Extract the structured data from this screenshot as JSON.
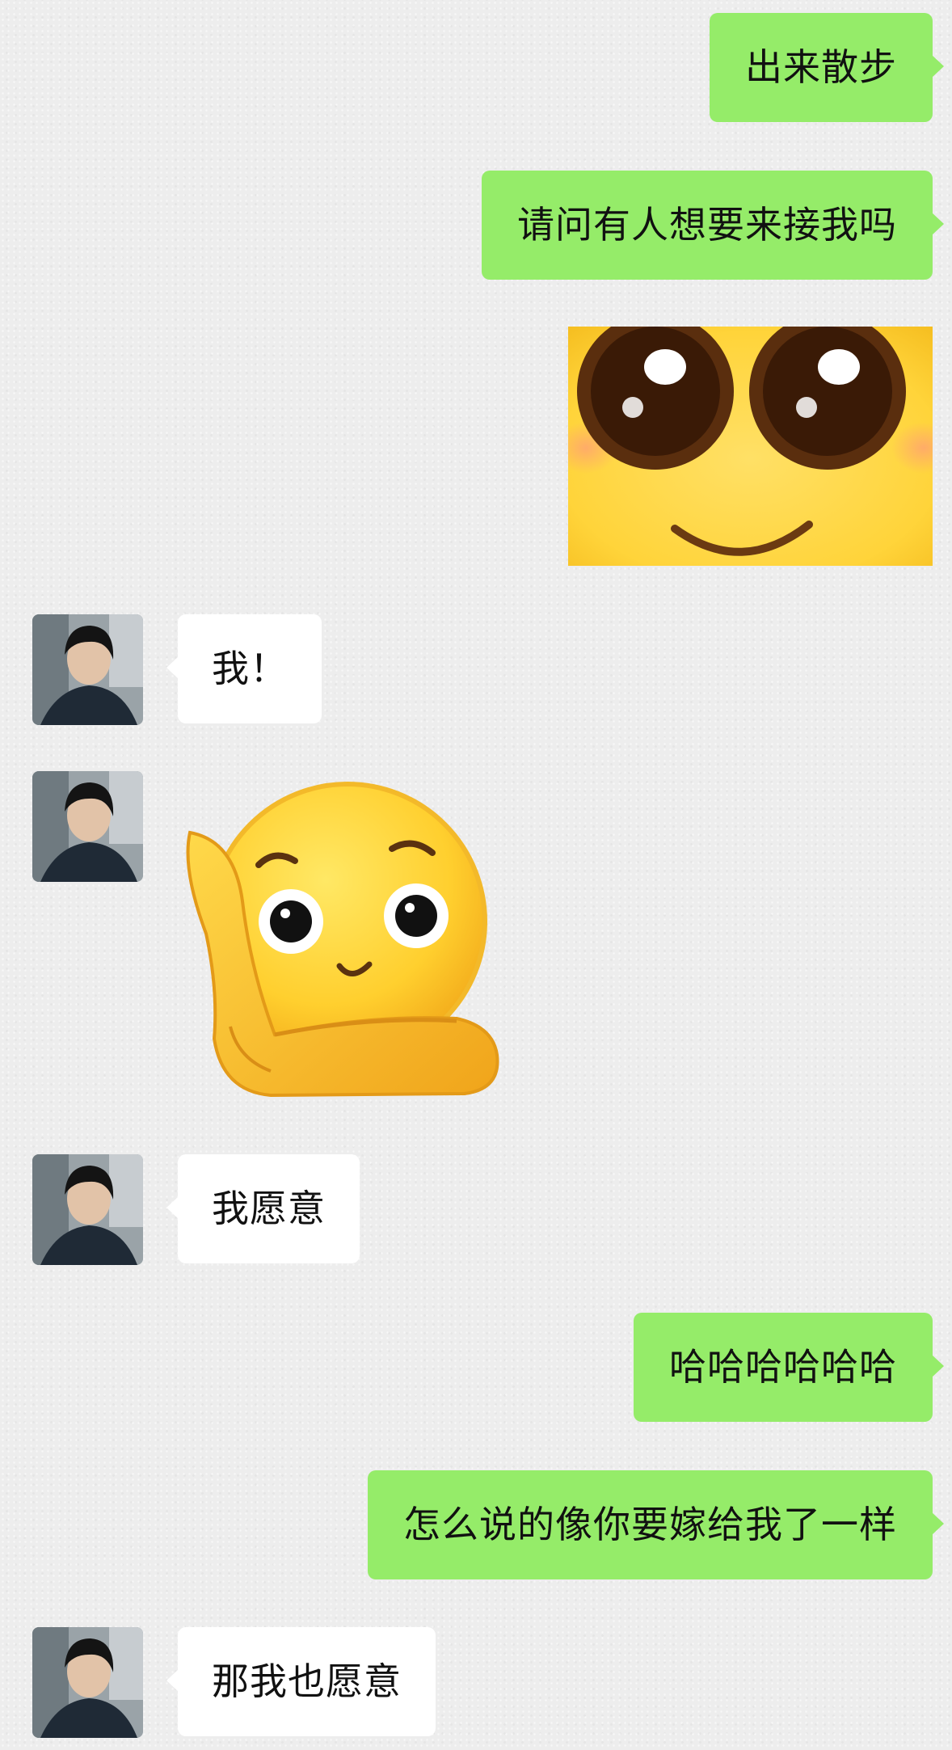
{
  "messages": [
    {
      "sender": "me",
      "type": "text",
      "text": "出来散步"
    },
    {
      "sender": "me",
      "type": "text",
      "text": "请问有人想要来接我吗"
    },
    {
      "sender": "me",
      "type": "sticker",
      "sticker": "cute-face-closeup-sticker"
    },
    {
      "sender": "other",
      "type": "text",
      "text": "我！"
    },
    {
      "sender": "other",
      "type": "sticker",
      "sticker": "hand-on-cheek-emoji-sticker"
    },
    {
      "sender": "other",
      "type": "text",
      "text": "我愿意"
    },
    {
      "sender": "me",
      "type": "text",
      "text": "哈哈哈哈哈哈"
    },
    {
      "sender": "me",
      "type": "text",
      "text": "怎么说的像你要嫁给我了一样"
    },
    {
      "sender": "other",
      "type": "text",
      "text": "那我也愿意"
    }
  ],
  "colors": {
    "background": "#ededed",
    "my_bubble": "#95ec69",
    "their_bubble": "#ffffff"
  },
  "icons": {
    "avatar": "person-avatar",
    "sticker_1": "cute-face-closeup-sticker",
    "sticker_2": "hand-on-cheek-emoji-sticker"
  }
}
